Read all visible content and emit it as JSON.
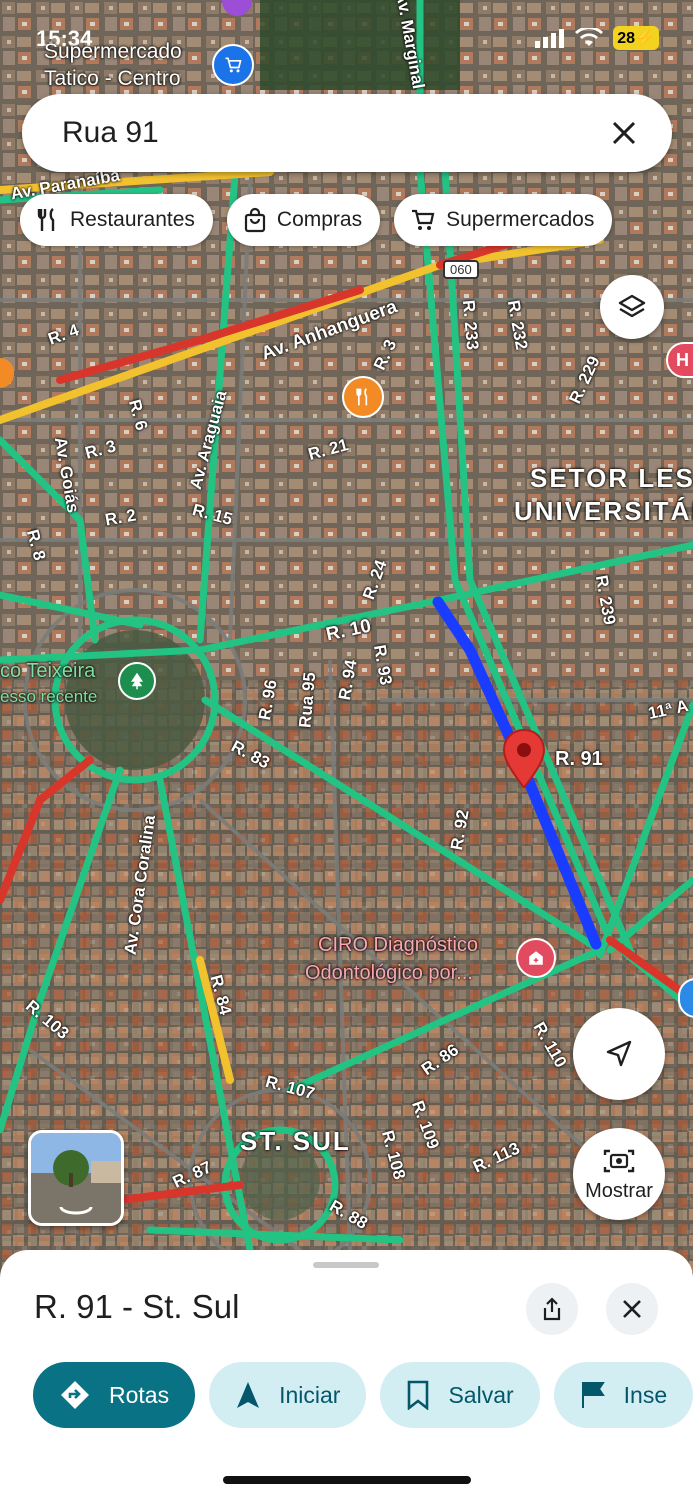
{
  "status_bar": {
    "time": "15:34",
    "battery": "28"
  },
  "search": {
    "query": "Rua 91"
  },
  "chips": [
    {
      "label": "Restaurantes",
      "icon": "fork-knife-icon"
    },
    {
      "label": "Compras",
      "icon": "shopping-bag-icon"
    },
    {
      "label": "Supermercados",
      "icon": "cart-icon"
    }
  ],
  "map": {
    "areas": {
      "setor_leste_1": "SETOR LEST",
      "setor_leste_2": "UNIVERSITÁR",
      "st_sul": "ST. SUL"
    },
    "roads": {
      "av_anhanguera": "Av. Anhanguera",
      "av_paranaiba": "Av. Paranaíba",
      "av_araguaia": "Av. Araguaia",
      "av_goias": "Av. Goiás",
      "av_cora_coralina": "Av. Cora Coralina",
      "av_marginal": "Av. Marginal",
      "r_91": "R. 91",
      "r_10": "R. 10",
      "r_83": "R. 83",
      "r_84": "R. 84",
      "r_86": "R. 86",
      "r_87": "R. 87",
      "r_88": "R. 88",
      "r_92": "R. 92",
      "r_93": "R. 93",
      "r_94": "R. 94",
      "rua_95": "Rua 95",
      "r_96": "R. 96",
      "r_103": "R. 103",
      "r_107": "R. 107",
      "r_108": "R. 108",
      "r_109": "R. 109",
      "r_110": "R. 110",
      "r_113": "R. 113",
      "r_21": "R. 21",
      "r_24": "R. 24",
      "r_3a": "R. 3",
      "r_3b": "R. 3",
      "r_4": "R. 4",
      "r_2": "R. 2",
      "r_6": "R. 6",
      "r_8": "R. 8",
      "r_15": "R. 15",
      "r_229": "R. 229",
      "r_232": "R. 232",
      "r_233": "R. 233",
      "r_239": "R. 239",
      "r_11a": "11ª A",
      "shield": "060"
    },
    "pois": {
      "supermarket_line1": "Supermercado",
      "supermarket_line2": "Tatico - Centro",
      "park_line1": "co Teixeira",
      "park_line2": "esso recente",
      "ciro_line1": "CIRO Diagnóstico",
      "ciro_line2": "Odontológico por..."
    },
    "show_label": "Mostrar"
  },
  "place": {
    "title": "R. 91 - St. Sul",
    "actions": [
      {
        "label": "Rotas",
        "icon": "directions-icon"
      },
      {
        "label": "Iniciar",
        "icon": "navigation-arrow-icon"
      },
      {
        "label": "Salvar",
        "icon": "bookmark-icon"
      },
      {
        "label": "Inse",
        "icon": "flag-icon"
      }
    ]
  },
  "colors": {
    "accent": "#0a7285",
    "route": "#1a3cff",
    "pin": "#e53935",
    "traffic_green": "#23c384",
    "traffic_yellow": "#f2c12e",
    "traffic_red": "#d8362b"
  }
}
